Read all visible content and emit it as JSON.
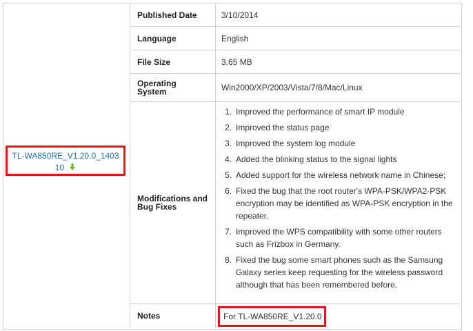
{
  "download": {
    "file_link": "TL-WA850RE_V1.20.0_140310",
    "file_link_line1": "TL-WA850RE_V1.20.0_1403",
    "file_link_line2": "10"
  },
  "rows": {
    "published": {
      "label": "Published Date",
      "value": "3/10/2014"
    },
    "language": {
      "label": "Language",
      "value": "English"
    },
    "filesize": {
      "label": "File Size",
      "value": "3.65 MB"
    },
    "os": {
      "label": "Operating System",
      "value": "Win2000/XP/2003/Vista/7/8/Mac/Linux"
    },
    "mods": {
      "label": "Modifications and Bug Fixes",
      "items": [
        "Improved the performance of smart IP module",
        "Improved the status page",
        "Improved the system log module",
        "Added the blinking status to the signal lights",
        "Added support for the wireless network name in Chinese;",
        "Fixed the bug that the root router's WPA-PSK/WPA2-PSK encryption may be identified as WPA-PSK encryption in the repeater.",
        "Improved the WPS compatibility with some other routers such as Frizbox in Germany.",
        "Fixed the bug some smart phones such as the Samsung Galaxy series keep requesting for the wireless password although that has been remembered before."
      ]
    },
    "notes": {
      "label": "Notes",
      "value": "For TL-WA850RE_V1.20.0"
    }
  },
  "colors": {
    "highlight": "#e2161b",
    "link": "#1a6eb0",
    "arrow": "#6ab023"
  },
  "icons": {
    "download": "download-arrow-icon"
  }
}
